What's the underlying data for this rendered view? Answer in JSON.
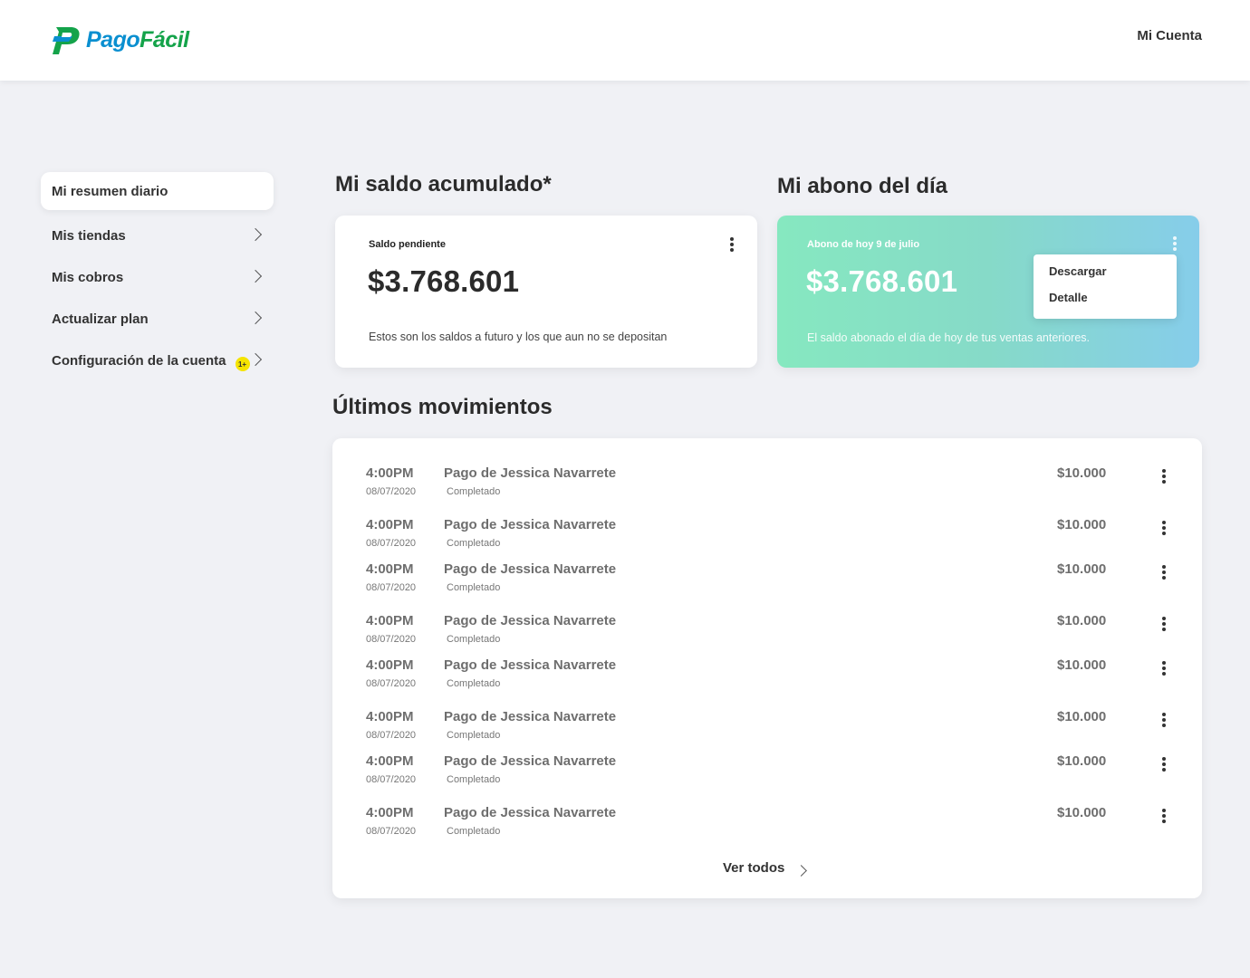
{
  "header": {
    "logo_part1": "Pago",
    "logo_part2": "Fácil",
    "account_label": "Mi Cuenta"
  },
  "sidebar": {
    "items": [
      {
        "label": "Mi resumen diario"
      },
      {
        "label": "Mis tiendas"
      },
      {
        "label": "Mis cobros"
      },
      {
        "label": "Actualizar plan"
      },
      {
        "label": "Configuración de la cuenta",
        "badge": "1+"
      }
    ]
  },
  "saldo": {
    "title": "Mi saldo acumulado*",
    "label": "Saldo pendiente",
    "amount": "$3.768.601",
    "description": "Estos son los saldos a futuro y los que aun no se depositan"
  },
  "abono": {
    "title": "Mi abono del día",
    "label": "Abono de hoy 9 de julio",
    "amount": "$3.768.601",
    "description": "El saldo abonado el día de hoy de tus ventas anteriores.",
    "menu": [
      "Descargar",
      "Detalle"
    ]
  },
  "movimientos": {
    "title": "Últimos movimientos",
    "rows": [
      {
        "time": "4:00PM",
        "date": "08/07/2020",
        "name": "Pago de Jessica Navarrete",
        "status": "Completado",
        "amount": "$10.000"
      },
      {
        "time": "4:00PM",
        "date": "08/07/2020",
        "name": "Pago de Jessica Navarrete",
        "status": "Completado",
        "amount": "$10.000"
      },
      {
        "time": "4:00PM",
        "date": "08/07/2020",
        "name": "Pago de Jessica Navarrete",
        "status": "Completado",
        "amount": "$10.000"
      },
      {
        "time": "4:00PM",
        "date": "08/07/2020",
        "name": "Pago de Jessica Navarrete",
        "status": "Completado",
        "amount": "$10.000"
      },
      {
        "time": "4:00PM",
        "date": "08/07/2020",
        "name": "Pago de Jessica Navarrete",
        "status": "Completado",
        "amount": "$10.000"
      },
      {
        "time": "4:00PM",
        "date": "08/07/2020",
        "name": "Pago de Jessica Navarrete",
        "status": "Completado",
        "amount": "$10.000"
      },
      {
        "time": "4:00PM",
        "date": "08/07/2020",
        "name": "Pago de Jessica Navarrete",
        "status": "Completado",
        "amount": "$10.000"
      },
      {
        "time": "4:00PM",
        "date": "08/07/2020",
        "name": "Pago de Jessica Navarrete",
        "status": "Completado",
        "amount": "$10.000"
      }
    ],
    "see_all": "Ver todos"
  },
  "colors": {
    "brand_blue": "#0a8fd0",
    "brand_green": "#14a34a",
    "badge": "#f5e400",
    "abono_gradient_start": "#86e8c0",
    "abono_gradient_end": "#86cdea"
  }
}
